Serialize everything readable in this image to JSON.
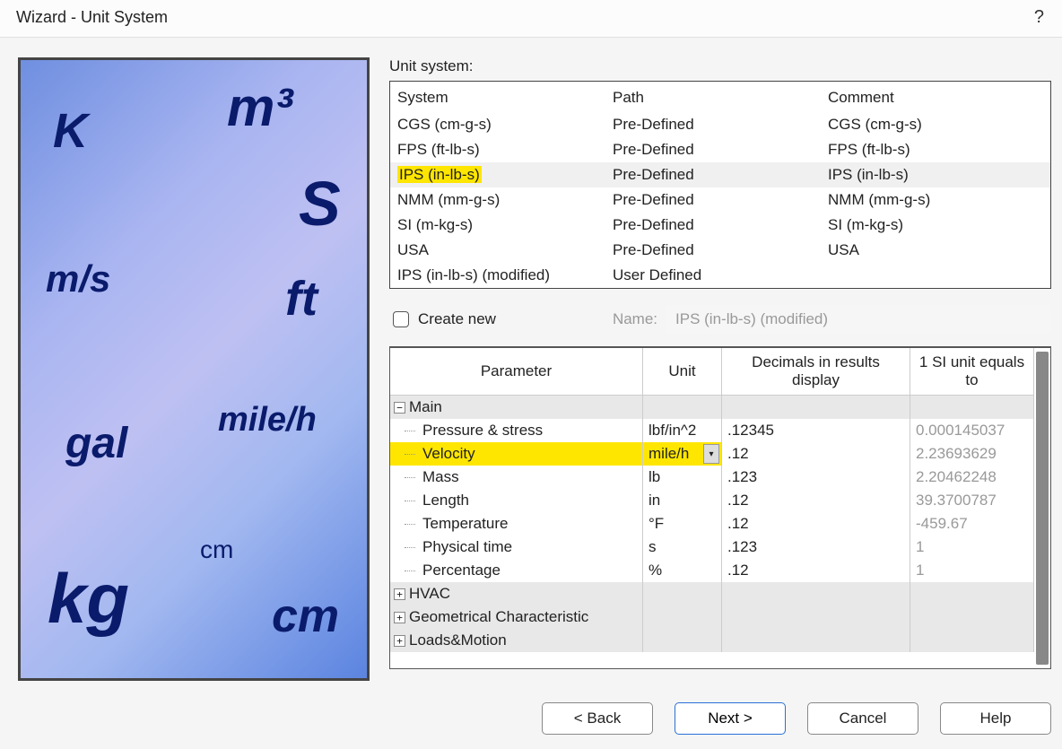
{
  "title": "Wizard - Unit System",
  "help_symbol": "?",
  "section_label": "Unit system:",
  "systems": {
    "headers": {
      "c1": "System",
      "c2": "Path",
      "c3": "Comment"
    },
    "rows": [
      {
        "system": "CGS (cm-g-s)",
        "path": "Pre-Defined",
        "comment": "CGS (cm-g-s)",
        "selected": false,
        "highlight": false
      },
      {
        "system": "FPS (ft-lb-s)",
        "path": "Pre-Defined",
        "comment": "FPS (ft-lb-s)",
        "selected": false,
        "highlight": false
      },
      {
        "system": "IPS (in-lb-s)",
        "path": "Pre-Defined",
        "comment": "IPS (in-lb-s)",
        "selected": true,
        "highlight": true
      },
      {
        "system": "NMM (mm-g-s)",
        "path": "Pre-Defined",
        "comment": "NMM (mm-g-s)",
        "selected": false,
        "highlight": false
      },
      {
        "system": "SI (m-kg-s)",
        "path": "Pre-Defined",
        "comment": "SI (m-kg-s)",
        "selected": false,
        "highlight": false
      },
      {
        "system": "USA",
        "path": "Pre-Defined",
        "comment": "USA",
        "selected": false,
        "highlight": false
      },
      {
        "system": "IPS (in-lb-s) (modified)",
        "path": "User Defined",
        "comment": "",
        "selected": false,
        "highlight": false
      }
    ]
  },
  "create": {
    "label": "Create new",
    "name_label": "Name:",
    "name_value": "IPS (in-lb-s) (modified)"
  },
  "params": {
    "headers": {
      "c1": "Parameter",
      "c2": "Unit",
      "c3": "Decimals in results display",
      "c4": "1 SI unit equals to"
    },
    "groups": [
      {
        "name": "Main",
        "expanded": true,
        "rows": [
          {
            "name": "Pressure & stress",
            "unit": "lbf/in^2",
            "decimals": ".12345",
            "si": "0.000145037",
            "highlight": false,
            "dropdown": false
          },
          {
            "name": "Velocity",
            "unit": "mile/h",
            "decimals": ".12",
            "si": "2.23693629",
            "highlight": true,
            "dropdown": true
          },
          {
            "name": "Mass",
            "unit": "lb",
            "decimals": ".123",
            "si": "2.20462248",
            "highlight": false,
            "dropdown": false
          },
          {
            "name": "Length",
            "unit": "in",
            "decimals": ".12",
            "si": "39.3700787",
            "highlight": false,
            "dropdown": false
          },
          {
            "name": "Temperature",
            "unit": "°F",
            "decimals": ".12",
            "si": "-459.67",
            "highlight": false,
            "dropdown": false
          },
          {
            "name": "Physical time",
            "unit": "s",
            "decimals": ".123",
            "si": "1",
            "highlight": false,
            "dropdown": false
          },
          {
            "name": "Percentage",
            "unit": "%",
            "decimals": ".12",
            "si": "1",
            "highlight": false,
            "dropdown": false
          }
        ]
      },
      {
        "name": "HVAC",
        "expanded": false,
        "rows": []
      },
      {
        "name": "Geometrical Characteristic",
        "expanded": false,
        "rows": []
      },
      {
        "name": "Loads&Motion",
        "expanded": false,
        "rows": []
      }
    ]
  },
  "buttons": {
    "back": "< Back",
    "next": "Next >",
    "cancel": "Cancel",
    "help": "Help"
  },
  "side_labels": {
    "K": "K",
    "m3": "m³",
    "ms": "m/s",
    "S": "S",
    "ft": "ft",
    "gal": "gal",
    "mileh": "mile/h",
    "kg": "kg",
    "cm_lbl": "cm",
    "cm2": "cm"
  }
}
